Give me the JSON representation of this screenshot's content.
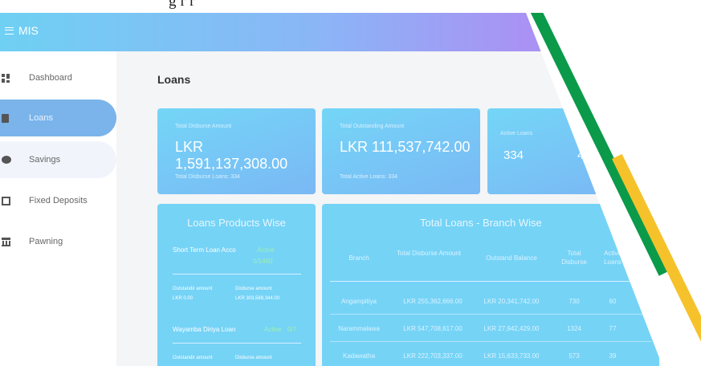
{
  "top_fragment": "g r r",
  "app": {
    "title": "MIS"
  },
  "sidebar": {
    "items": [
      {
        "label": "Dashboard",
        "icon": "dashboard-icon"
      },
      {
        "label": "Loans",
        "icon": "document-icon",
        "active": true
      },
      {
        "label": "Savings",
        "icon": "piggy-bank-icon"
      },
      {
        "label": "Fixed Deposits",
        "icon": "deposit-icon"
      },
      {
        "label": "Pawning",
        "icon": "bank-icon"
      }
    ]
  },
  "page": {
    "title": "Loans"
  },
  "cards": {
    "disburse": {
      "caption": "Total Disburse Amount",
      "value": "LKR 1,591,137,308.00",
      "sub": "Total Disburse Loans: 334"
    },
    "outstanding": {
      "caption": "Total Outstanding Amount",
      "value": "LKR 111,537,742.00",
      "sub": "Total Active Loans: 334"
    },
    "active": {
      "caption": "Active Loans",
      "value": "334",
      "value2": "4"
    }
  },
  "products": {
    "title": "Loans Products Wise",
    "items": [
      {
        "name": "Short Term Loan Acco",
        "status": "Active",
        "count": "0/1460",
        "outstanding_label": "Outstandir amount",
        "outstanding_value": "LKR 0.00",
        "disburse_label": "Disburse amount",
        "disburse_value": "LKR 303,588,344.00"
      },
      {
        "name": "Wayamba Diriya Loan",
        "status": "Active",
        "count": "0/7",
        "outstanding_label": "Outstandir amount",
        "outstanding_value": "",
        "disburse_label": "Disburse amount",
        "disburse_value": ""
      }
    ]
  },
  "branches": {
    "title": "Total Loans - Branch Wise",
    "columns": [
      "Branch",
      "Total Disburse Amount",
      "Outstand Balance",
      "Total Disburse",
      "Active Loans"
    ],
    "rows": [
      [
        "Angampitiya",
        "LKR 255,362,666.00",
        "LKR 20,341,742.00",
        "730",
        "60"
      ],
      [
        "Narammalawa",
        "LKR 547,708,617.00",
        "LKR 27,942,429.00",
        "1324",
        "77"
      ],
      [
        "Kadawatha",
        "LKR 222,703,337.00",
        "LKR 15,633,733.00",
        "573",
        "39"
      ]
    ]
  },
  "overlay_colors": {
    "green": "#0b9a4a",
    "yellow": "#f6c22b"
  }
}
